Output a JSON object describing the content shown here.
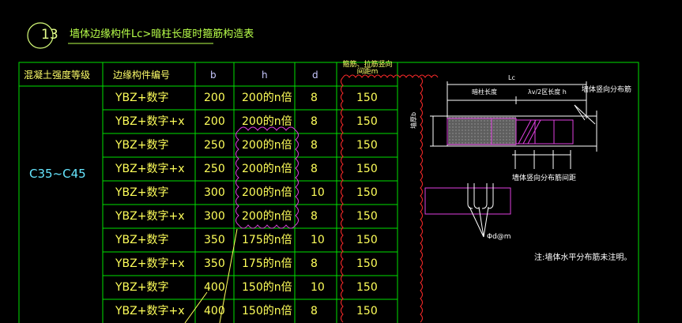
{
  "drawing": {
    "number": "13",
    "title": "墙体边缘构件Lc>暗柱长度时箍筋构造表"
  },
  "table": {
    "headers": {
      "grade": "混凝土强度等级",
      "component": "边缘构件编号",
      "b": "b",
      "h": "h",
      "d": "d",
      "spacing": "箍筋、拉筋竖向间距m"
    },
    "grade_value": "C35~C45",
    "rows": [
      {
        "component": "YBZ+数字",
        "b": "200",
        "h": "200的n倍",
        "d": "8",
        "spacing": "150"
      },
      {
        "component": "YBZ+数字+x",
        "b": "200",
        "h": "200的n倍",
        "d": "8",
        "spacing": "150"
      },
      {
        "component": "YBZ+数字",
        "b": "250",
        "h": "200的n倍",
        "d": "8",
        "spacing": "150"
      },
      {
        "component": "YBZ+数字+x",
        "b": "250",
        "h": "200的n倍",
        "d": "8",
        "spacing": "150"
      },
      {
        "component": "YBZ+数字",
        "b": "300",
        "h": "200的n倍",
        "d": "10",
        "spacing": "150"
      },
      {
        "component": "YBZ+数字+x",
        "b": "300",
        "h": "200的n倍",
        "d": "8",
        "spacing": "150"
      },
      {
        "component": "YBZ+数字",
        "b": "350",
        "h": "175的n倍",
        "d": "10",
        "spacing": "150"
      },
      {
        "component": "YBZ+数字+x",
        "b": "350",
        "h": "175的n倍",
        "d": "8",
        "spacing": "150"
      },
      {
        "component": "YBZ+数字",
        "b": "400",
        "h": "150的n倍",
        "d": "10",
        "spacing": "150"
      },
      {
        "component": "YBZ+数字+x",
        "b": "400",
        "h": "150的n倍",
        "d": "8",
        "spacing": "150"
      }
    ]
  },
  "detail": {
    "lc_label": "Lc",
    "dark_col_length": "暗柱长度",
    "half_length": "λv/2区长度 h",
    "wall_vertical_bar": "墙体竖向分布筋",
    "wall_vertical_spacing": "墙体竖向分布筋间距",
    "wall_thickness": "墙厚b",
    "rebar_label": "Φd@m",
    "note": "注:墙体水平分布筋未注明。"
  },
  "colors": {
    "background": "#000000",
    "grid": "#00e000",
    "text_yellow": "#ffff5a",
    "text_cyan": "#66e6ff",
    "cloud_red": "#ff2a2a",
    "cloud_magenta": "#e040e0",
    "hatch_magenta": "#e040e0"
  }
}
